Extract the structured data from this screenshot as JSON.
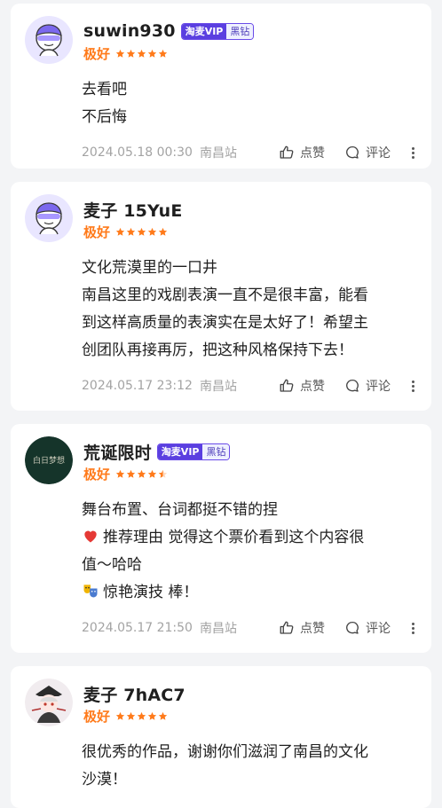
{
  "reviews": [
    {
      "username": "suwin930",
      "badge": {
        "vip": "淘麦VIP",
        "tier": "黑钻"
      },
      "rating_text": "极好",
      "stars": 5,
      "lines": [
        "去看吧",
        "不后悔"
      ],
      "timestamp": "2024.05.18 00:30",
      "location": "南昌站",
      "like_label": "点赞",
      "comment_label": "评论"
    },
    {
      "username": "麦子 15YuE",
      "rating_text": "极好",
      "stars": 5,
      "lines": [
        "文化荒漠里的一口井",
        "南昌这里的戏剧表演一直不是很丰富，能看",
        "到这样高质量的表演实在是太好了！希望主",
        "创团队再接再厉，把这种风格保持下去！"
      ],
      "timestamp": "2024.05.17 23:12",
      "location": "南昌站",
      "like_label": "点赞",
      "comment_label": "评论"
    },
    {
      "username": "荒诞限时",
      "badge": {
        "vip": "淘麦VIP",
        "tier": "黑钻"
      },
      "avatar_text": "白日梦想",
      "rating_text": "极好",
      "stars": 4.5,
      "lines": [
        "舞台布置、台词都挺不错的捏",
        "推荐理由 觉得这个票价看到这个内容很",
        "值～哈哈",
        "惊艳演技 棒！"
      ],
      "timestamp": "2024.05.17 21:50",
      "location": "南昌站",
      "like_label": "点赞",
      "comment_label": "评论"
    },
    {
      "username": "麦子 7hAC7",
      "rating_text": "极好",
      "stars": 5,
      "lines": [
        "很优秀的作品，谢谢你们滋润了南昌的文化",
        "沙漠！"
      ]
    }
  ],
  "colors": {
    "rating": "#ff7a1a",
    "vip": "#5a3fe0",
    "page_bg": "#f3f4f6"
  },
  "icons": {
    "like": "thumbs-up-icon",
    "comment": "comment-bubble-icon",
    "more": "more-vertical-icon"
  }
}
